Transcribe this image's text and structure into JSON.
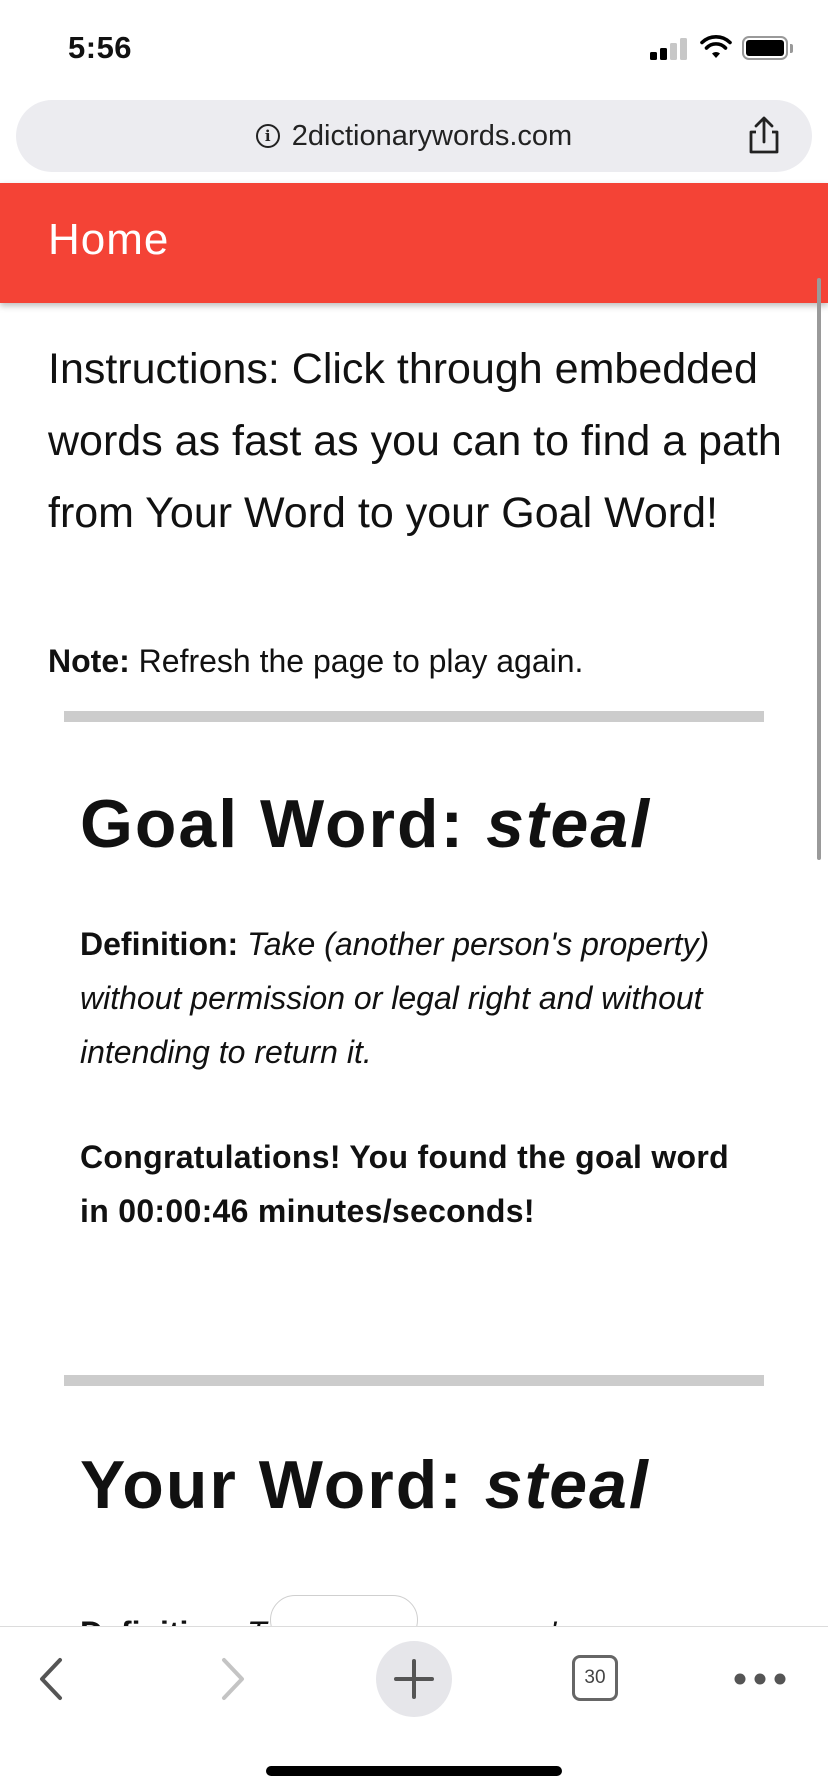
{
  "status_bar": {
    "time": "5:56"
  },
  "browser": {
    "url": "2dictionarywords.com",
    "tab_count": "30"
  },
  "header": {
    "title": "Home"
  },
  "instructions": {
    "label": "Instructions:",
    "text": " Click through embedded words as fast as you can to find a path from Your Word to your Goal Word!"
  },
  "note": {
    "label": "Note:",
    "text": " Refresh the page to play again."
  },
  "goal": {
    "heading_label": "Goal Word: ",
    "word": "steal",
    "definition_label": "Definition:",
    "definition_text": " Take (another person's property) without permission or legal right and without intending to return it.",
    "congrats": "Congratulations! You found the goal word in 00:00:46 minutes/seconds!"
  },
  "your_word": {
    "heading_label": "Your Word: ",
    "word": "steal",
    "definition_label": "Definition:",
    "definition_text": " Take (another person's"
  },
  "icons": {
    "info": "info-icon",
    "share": "share-icon",
    "back": "chevron-left-icon",
    "forward": "chevron-right-icon",
    "new_tab": "plus-icon",
    "tabs": "tabs-icon",
    "more": "more-icon"
  },
  "colors": {
    "header_bg": "#f44336",
    "divider": "#cccccc"
  }
}
